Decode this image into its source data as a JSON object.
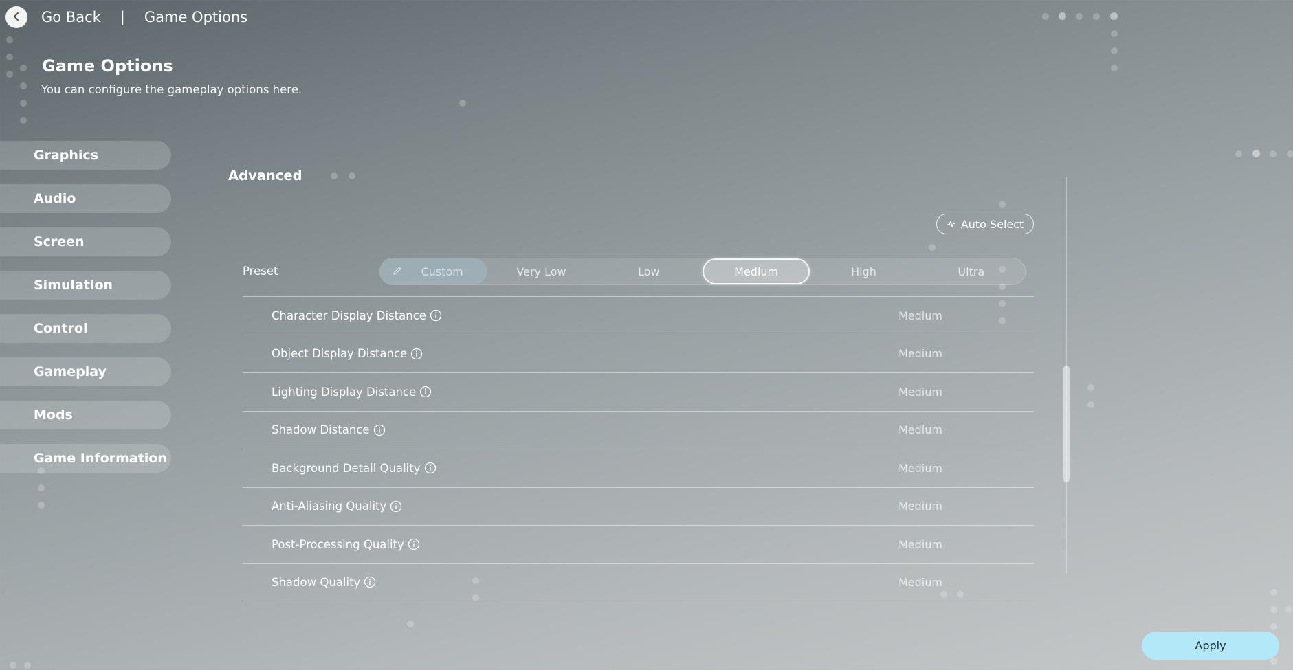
{
  "topbar": {
    "back_label": "Go Back",
    "separator": "|",
    "crumb": "Game Options"
  },
  "header": {
    "title": "Game Options",
    "subtitle": "You can configure the gameplay options here."
  },
  "sidebar": {
    "items": [
      {
        "label": "Graphics"
      },
      {
        "label": "Audio"
      },
      {
        "label": "Screen"
      },
      {
        "label": "Simulation"
      },
      {
        "label": "Control"
      },
      {
        "label": "Gameplay"
      },
      {
        "label": "Mods"
      },
      {
        "label": "Game Information"
      }
    ]
  },
  "content": {
    "section_title": "Advanced",
    "auto_select_label": "Auto Select",
    "preset": {
      "label": "Preset",
      "options": [
        "Custom",
        "Very Low",
        "Low",
        "Medium",
        "High",
        "Ultra"
      ],
      "selected": "Medium"
    },
    "settings": [
      {
        "label": "Character Display Distance",
        "value": "Medium"
      },
      {
        "label": "Object Display Distance",
        "value": "Medium"
      },
      {
        "label": "Lighting Display Distance",
        "value": "Medium"
      },
      {
        "label": "Shadow Distance",
        "value": "Medium"
      },
      {
        "label": "Background Detail Quality",
        "value": "Medium"
      },
      {
        "label": "Anti-Aliasing Quality",
        "value": "Medium"
      },
      {
        "label": "Post-Processing Quality",
        "value": "Medium"
      },
      {
        "label": "Shadow Quality",
        "value": "Medium"
      }
    ]
  },
  "footer": {
    "apply_label": "Apply"
  },
  "colors": {
    "apply_button": "#b3e8f8",
    "custom_highlight": "#a5becd"
  },
  "icons": {
    "back": "chevron-left-icon",
    "auto_select": "pulse-icon",
    "custom": "pencil-icon",
    "info": "info-icon"
  }
}
